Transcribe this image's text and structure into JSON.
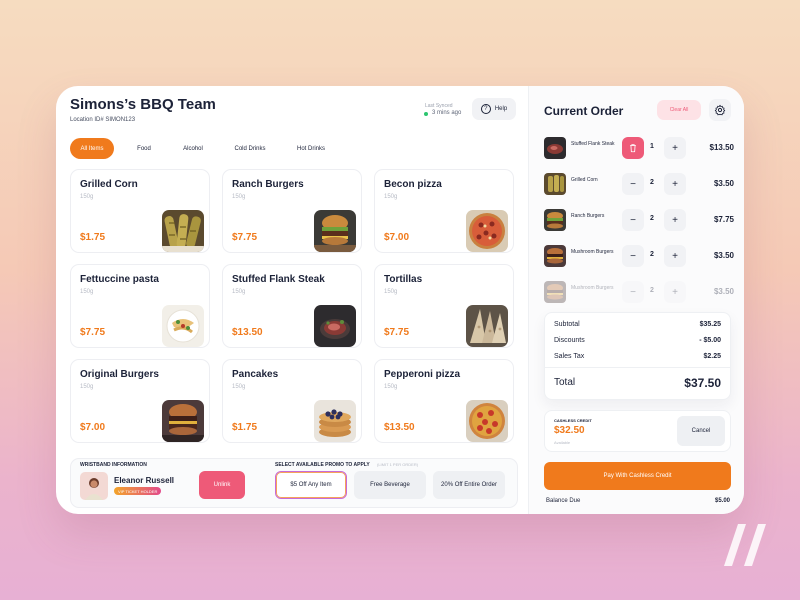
{
  "header": {
    "title": "Simons’s BBQ Team",
    "location": "Location ID# SIMON123",
    "last_synced_label": "Last Synced",
    "last_synced_time": "3 mins ago",
    "help_label": "Help"
  },
  "tabs": [
    {
      "label": "All Items",
      "active": true
    },
    {
      "label": "Food",
      "active": false
    },
    {
      "label": "Alcohol",
      "active": false
    },
    {
      "label": "Cold Drinks",
      "active": false
    },
    {
      "label": "Hot Drinks",
      "active": false
    }
  ],
  "menu_items": [
    {
      "name": "Grilled Corn",
      "weight": "150g",
      "price": "$1.75",
      "icon": "grilled-corn-photo"
    },
    {
      "name": "Ranch Burgers",
      "weight": "150g",
      "price": "$7.75",
      "icon": "burger-photo"
    },
    {
      "name": "Becon pizza",
      "weight": "150g",
      "price": "$7.00",
      "icon": "pizza-photo"
    },
    {
      "name": "Fettuccine pasta",
      "weight": "150g",
      "price": "$7.75",
      "icon": "pasta-photo"
    },
    {
      "name": "Stuffed Flank Steak",
      "weight": "150g",
      "price": "$13.50",
      "icon": "steak-photo"
    },
    {
      "name": "Tortillas",
      "weight": "150g",
      "price": "$7.75",
      "icon": "tortilla-photo"
    },
    {
      "name": "Original Burgers",
      "weight": "150g",
      "price": "$7.00",
      "icon": "burger-photo"
    },
    {
      "name": "Pancakes",
      "weight": "150g",
      "price": "$1.75",
      "icon": "pancakes-photo"
    },
    {
      "name": "Pepperoni pizza",
      "weight": "150g",
      "price": "$13.50",
      "icon": "pizza-photo"
    }
  ],
  "wristband": {
    "label": "WRISTBAND INFORMATION",
    "customer_name": "Eleanor Russell",
    "badge": "VIP TICKET HOLDER",
    "unlink_label": "Unlink"
  },
  "promos": {
    "label": "SELECT AVAILABLE PROMO TO APPLY",
    "limit": "(LIMIT 1 PER ORDER)",
    "options": [
      {
        "label": "$5 Off Any Item",
        "selected": true
      },
      {
        "label": "Free Beverage",
        "selected": false
      },
      {
        "label": "20% Off Entire Order",
        "selected": false
      }
    ]
  },
  "current_order": {
    "title": "Current Order",
    "clear_label": "Clear All",
    "items": [
      {
        "name": "Stuffed Flank Steak",
        "qty": "1",
        "price": "$13.50",
        "action": "trash-icon",
        "icon": "steak-photo"
      },
      {
        "name": "Grilled Corn",
        "qty": "2",
        "price": "$3.50",
        "action": "minus-icon",
        "icon": "grilled-corn-photo"
      },
      {
        "name": "Ranch Burgers",
        "qty": "2",
        "price": "$7.75",
        "action": "minus-icon",
        "icon": "burger-photo"
      },
      {
        "name": "Mushroom Burgers",
        "qty": "2",
        "price": "$3.50",
        "action": "minus-icon",
        "icon": "burger-photo"
      },
      {
        "name": "Mushroom Burgers",
        "qty": "2",
        "price": "$3.50",
        "action": "minus-icon",
        "icon": "burger-photo"
      }
    ]
  },
  "totals": {
    "subtotal_label": "Subtotal",
    "subtotal": "$35.25",
    "discounts_label": "Discounts",
    "discounts": "- $5.00",
    "tax_label": "Sales Tax",
    "tax": "$2.25",
    "total_label": "Total",
    "total": "$37.50"
  },
  "cashless": {
    "label": "CASHLESS CREDIT",
    "amount": "$32.50",
    "available_label": "Available",
    "cancel_label": "Cancel"
  },
  "payment": {
    "pay_label": "Pay With Cashless Credit",
    "balance_label": "Balance Due",
    "balance": "$5.00"
  },
  "colors": {
    "accent": "#f07a1c",
    "danger": "#ee5a78",
    "text": "#1c2238",
    "muted": "#b7bbc5",
    "synced": "#2cc56f"
  }
}
